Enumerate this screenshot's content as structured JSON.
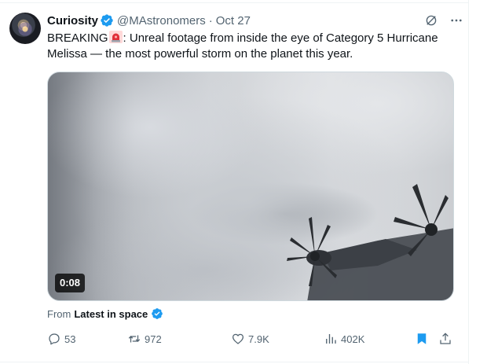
{
  "tweet": {
    "author_name": "Curiosity",
    "handle": "@MAstronomers",
    "separator": "·",
    "date": "Oct 27",
    "text_part1": "BREAKING",
    "text_part2": ": Unreal footage from inside the eye of Category 5 Hurricane Melissa — the most powerful storm on the planet this year.",
    "emoji": "rotating-light-emoji"
  },
  "media": {
    "duration": "0:08"
  },
  "source": {
    "prefix": "From",
    "name": "Latest in space"
  },
  "actions": {
    "replies": "53",
    "reposts": "972",
    "likes": "7.9K",
    "views": "402K"
  },
  "colors": {
    "verified": "#1d9bf0",
    "text": "#0f1419",
    "secondary": "#536471",
    "bookmark": "#1d9bf0"
  },
  "icons": {
    "verified": "verified-badge-icon",
    "grok": "grok-icon",
    "more": "more-icon",
    "reply": "reply-icon",
    "repost": "repost-icon",
    "like": "heart-icon",
    "views": "views-icon",
    "bookmark": "bookmark-icon",
    "share": "share-icon"
  }
}
